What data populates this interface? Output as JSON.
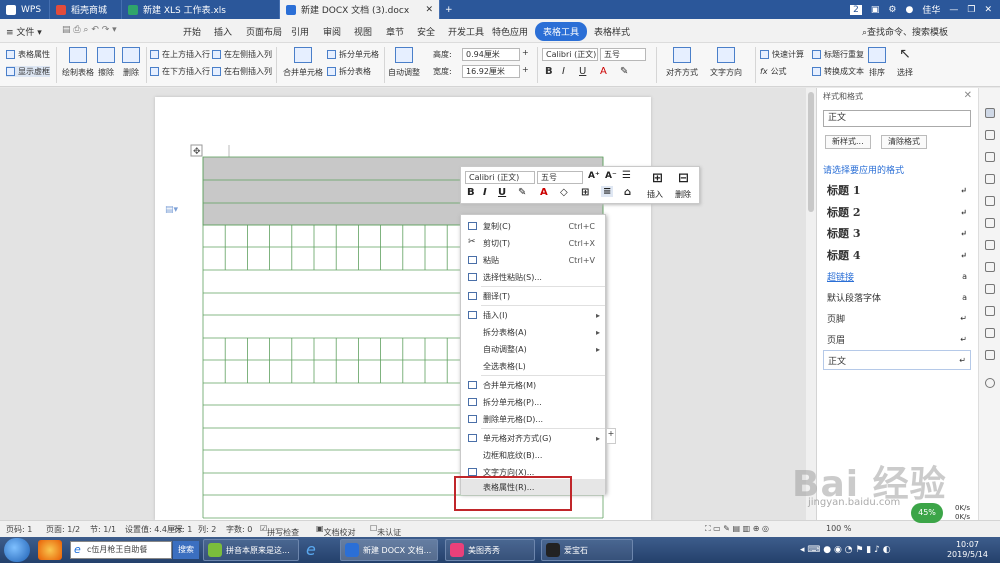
{
  "titlebar": {
    "tabs": [
      {
        "label": "WPS"
      },
      {
        "label": "稻壳商城"
      },
      {
        "label": "新建 XLS 工作表.xls"
      },
      {
        "label": "新建 DOCX 文档 (3).docx"
      }
    ],
    "badge": "2",
    "user": "佳华"
  },
  "menubar": {
    "file": "文件",
    "items": [
      "开始",
      "插入",
      "页面布局",
      "引用",
      "审阅",
      "视图",
      "章节",
      "安全",
      "开发工具",
      "特色应用",
      "表格工具",
      "表格样式"
    ],
    "search": "查找命令、搜索模板"
  },
  "ribbon": {
    "table_props": "表格属性",
    "show_gridlines": "显示虚框",
    "draw_table": "绘制表格",
    "erase": "擦除",
    "delete": "删除",
    "insert_above": "在上方插入行",
    "insert_below": "在下方插入行",
    "insert_left": "在左侧插入列",
    "insert_right": "在右侧插入列",
    "merge_cells": "合并单元格",
    "split_cells": "拆分单元格",
    "split_table": "拆分表格",
    "auto_fit": "自动调整",
    "height_label": "高度:",
    "height_value": "0.94厘米",
    "width_label": "宽度:",
    "width_value": "16.92厘米",
    "font": "Calibri (正文)",
    "font_size": "五号",
    "align": "对齐方式",
    "text_dir": "文字方向",
    "quick_calc": "快速计算",
    "title_repeat": "标题行重复",
    "convert_text": "转换成文本",
    "sort": "排序",
    "select": "选择",
    "formula": "公式"
  },
  "minibar": {
    "font": "Calibri (正文)",
    "size": "五号",
    "insert": "插入",
    "delete": "删除"
  },
  "context_menu": {
    "copy": "复制(C)",
    "copy_sc": "Ctrl+C",
    "cut": "剪切(T)",
    "cut_sc": "Ctrl+X",
    "paste": "粘贴",
    "paste_sc": "Ctrl+V",
    "paste_special": "选择性粘贴(S)...",
    "translate": "翻译(T)",
    "insert": "插入(I)",
    "split_table": "拆分表格(A)",
    "auto_fit": "自动调整(A)",
    "select_all": "全选表格(L)",
    "merge": "合并单元格(M)",
    "split_cells": "拆分单元格(P)...",
    "delete_cells": "删除单元格(D)...",
    "cell_align": "单元格对齐方式(G)",
    "borders": "边框和底纹(B)...",
    "text_dir": "文字方向(X)...",
    "table_props": "表格属性(R)..."
  },
  "styles_pane": {
    "title": "样式和格式",
    "current": "正文",
    "new_style": "新样式...",
    "clear_format": "清除格式",
    "subtitle": "请选择要应用的格式",
    "items": [
      "标题 1",
      "标题 2",
      "标题 3",
      "标题 4",
      "超链接",
      "默认段落字体",
      "页脚",
      "页眉",
      "正文"
    ]
  },
  "statusbar": {
    "pages": "页码: 1",
    "page_of": "页面: 1/2",
    "section": "节: 1/1",
    "setting": "设置值: 4.4厘米",
    "row": "行: 1",
    "col": "列: 2",
    "words": "字数: 0",
    "spell": "拼写检查",
    "proof": "文档校对",
    "cert": "未认证",
    "zoom": "100 %"
  },
  "taskbar": {
    "search_text": "c伍月枪王自助餐",
    "search_btn": "搜索",
    "items": [
      "拼音本原来是这...",
      "新建 DOCX 文档...",
      "美图秀秀",
      "爱宝石"
    ],
    "time": "10:07",
    "date": "2019/5/14",
    "net_percent": "45%",
    "up": "0K/s",
    "down": "0K/s"
  },
  "watermark": {
    "text": "Bai 经验",
    "url": "jingyan.baidu.com"
  }
}
